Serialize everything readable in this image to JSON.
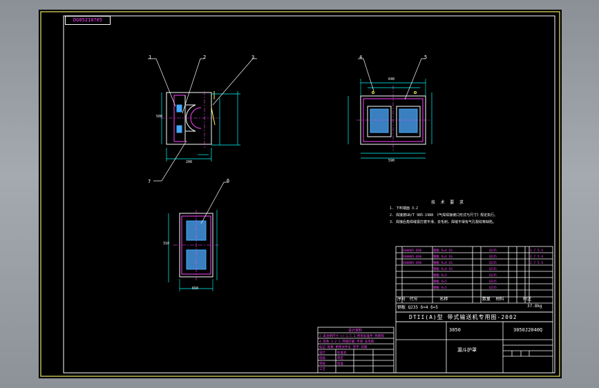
{
  "drawing_id": "DG05210705",
  "callouts": [
    "1",
    "2",
    "3",
    "4",
    "5",
    "6",
    "7"
  ],
  "dims": {
    "view1_bottom": "200",
    "view1_left": "500",
    "view2_top": "640",
    "view2_bottom": "590",
    "view3_bottom": "650",
    "view3_left": "310"
  },
  "notes": {
    "heading": "技 术 要 求",
    "lines": [
      "1. 下料端面 3.2",
      "2. 焊接按GB/T 985-1988 《气焊焊接坡口形式与尺寸》规定执行。",
      "3. 焊接后角焊缝需打磨平滑，去毛刺，焊缝不得有气孔裂纹等缺陷。"
    ]
  },
  "title_block": {
    "machine": "DTII(A)型 带式输送机专用图-2002",
    "spec_left": "3050",
    "drawing_no": "3050J2040Q",
    "part_name": "漏斗护罩",
    "weight": "37.8kg",
    "material_row": "钢板 Q235  δ=4  δ=5",
    "bom_headers": [
      "序号",
      "代号",
      "名称",
      "数量",
      "材料",
      "附注"
    ]
  },
  "sign_block": {
    "header": "设计资料"
  }
}
